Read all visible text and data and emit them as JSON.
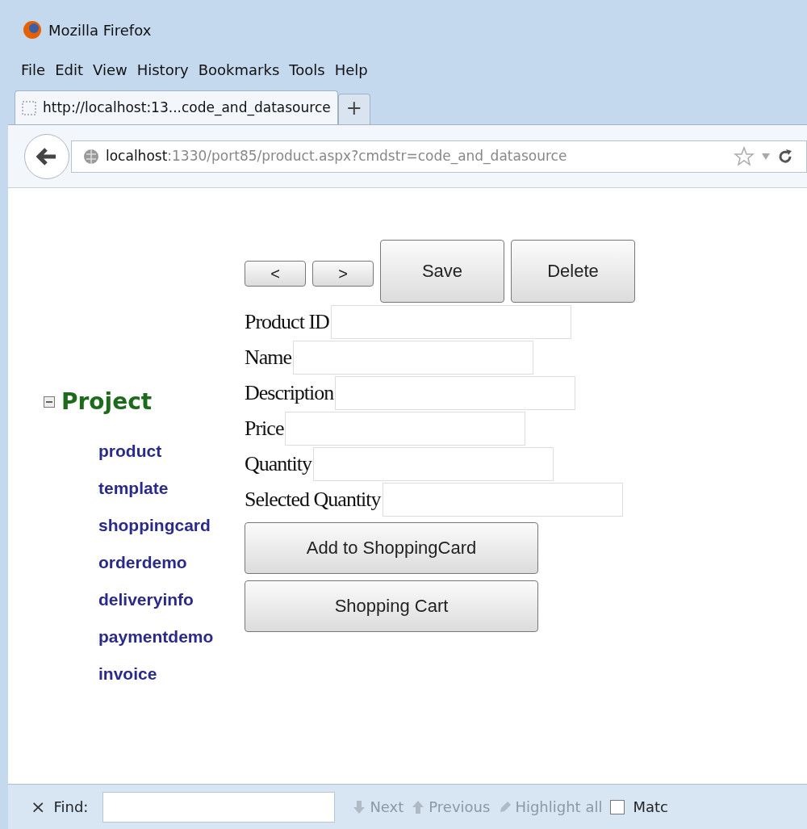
{
  "window": {
    "title": "Mozilla Firefox"
  },
  "menu": [
    "File",
    "Edit",
    "View",
    "History",
    "Bookmarks",
    "Tools",
    "Help"
  ],
  "tabs": [
    {
      "label": "http://localhost:13...code_and_datasource",
      "selected": true
    }
  ],
  "new_tab": "+",
  "address": {
    "host": "localhost",
    "rest": ":1330/port85/product.aspx?cmdstr=code_and_datasource"
  },
  "tree": {
    "label": "Project",
    "expanded": true,
    "children": [
      {
        "label": "product"
      },
      {
        "label": "template"
      },
      {
        "label": "shoppingcard"
      },
      {
        "label": "orderdemo"
      },
      {
        "label": "deliveryinfo"
      },
      {
        "label": "paymentdemo"
      },
      {
        "label": "invoice"
      }
    ]
  },
  "nav_buttons": [
    {
      "label": "<",
      "kind": "small"
    },
    {
      "label": ">",
      "kind": "small"
    },
    {
      "label": "Save",
      "kind": "large"
    },
    {
      "label": "Delete",
      "kind": "large"
    }
  ],
  "fields": [
    {
      "label": "Product ID"
    },
    {
      "label": "Name"
    },
    {
      "label": "Description"
    },
    {
      "label": "Price"
    },
    {
      "label": "Quantity"
    },
    {
      "label": "Selected Quantity"
    }
  ],
  "actions": [
    "Add to ShoppingCard",
    "Shopping Cart"
  ],
  "find_bar": {
    "close": "×",
    "label": "Find:",
    "buttons": [
      {
        "label": "Next",
        "disabled": true,
        "kind": "down"
      },
      {
        "label": "Previous",
        "disabled": true,
        "kind": "up"
      },
      {
        "label": "Highlight all",
        "disabled": true,
        "kind": "marker"
      }
    ],
    "match": {
      "label": "Matc",
      "checked": false
    }
  }
}
